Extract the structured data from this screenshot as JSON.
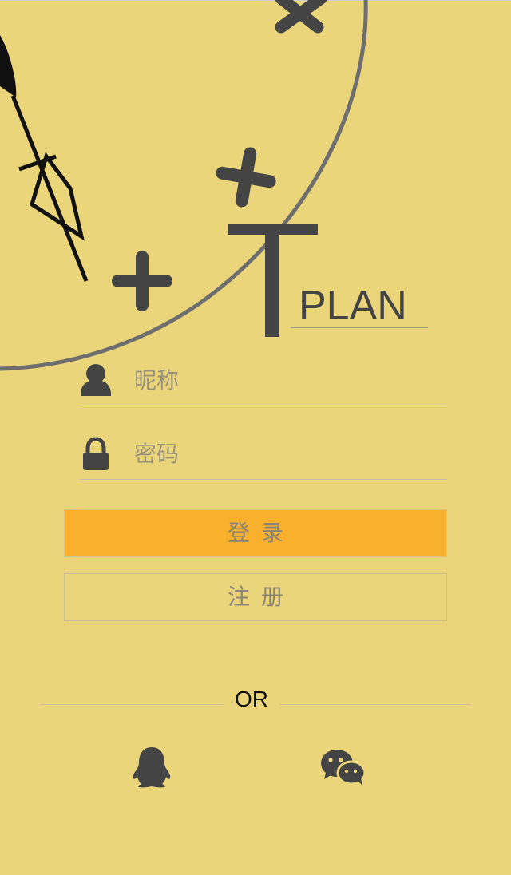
{
  "colors": {
    "background": "#ebd57b",
    "icon_dark": "#444444",
    "login_button": "#f9b02c"
  },
  "logo": {
    "text": "PLAN"
  },
  "form": {
    "nickname": {
      "placeholder": "昵称",
      "icon": "user-icon"
    },
    "password": {
      "placeholder": "密码",
      "icon": "lock-icon"
    }
  },
  "buttons": {
    "login_label": "登录",
    "register_label": "注册"
  },
  "divider": {
    "text": "OR"
  },
  "social": [
    {
      "icon": "qq-penguin-icon"
    },
    {
      "icon": "wechat-icon"
    }
  ]
}
